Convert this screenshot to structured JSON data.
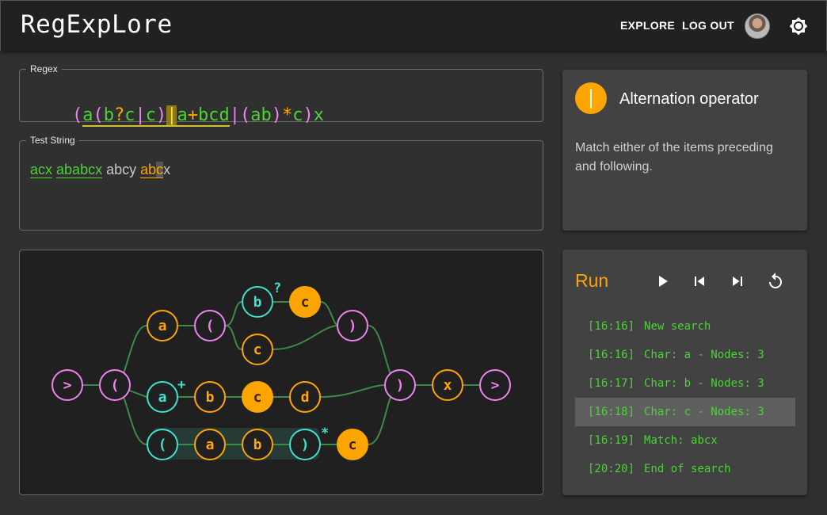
{
  "app": {
    "title": "RegExpLore"
  },
  "nav": {
    "explore": "EXPLORE",
    "logout": "LOG OUT"
  },
  "regex": {
    "label": "Regex",
    "tokens": [
      "(",
      "a",
      "(",
      "b",
      "?",
      "c",
      "|",
      "c",
      ")",
      "|",
      "a",
      "+",
      "b",
      "c",
      "d",
      "|",
      "(",
      "a",
      "b",
      ")",
      "*",
      "c",
      ")",
      "x"
    ]
  },
  "test": {
    "label": "Test String",
    "parts": [
      "acx",
      " ",
      "ababcx",
      " abcy ",
      "ab",
      "c",
      "x"
    ]
  },
  "operator": {
    "symbol": "|",
    "title": "Alternation operator",
    "description": "Match either of the items preceding and following."
  },
  "graph": {
    "nodes": [
      ">",
      "(",
      "a",
      "(",
      "b",
      "c",
      "c",
      ")",
      "a",
      "b",
      "c",
      "d",
      "(",
      "a",
      "b",
      ")",
      "c",
      ")",
      "x",
      ">"
    ],
    "quantifiers": [
      "?",
      "+",
      "*"
    ]
  },
  "run": {
    "title": "Run",
    "log": [
      {
        "time": "[16:16]",
        "text": "New search"
      },
      {
        "time": "[16:16]",
        "text": "Char: a - Nodes: 3"
      },
      {
        "time": "[16:17]",
        "text": "Char: b - Nodes: 3"
      },
      {
        "time": "[16:18]",
        "text": "Char: c - Nodes: 3"
      },
      {
        "time": "[16:19]",
        "text": "Match: abcx"
      },
      {
        "time": "[20:20]",
        "text": "End of search"
      }
    ],
    "active_index": 3
  },
  "colors": {
    "bracket": "#ee82ee",
    "literal": "#4cd137",
    "active": "#ffa500",
    "quantifier_group": "#40e0d0",
    "background": "#303030",
    "appbar": "#212121"
  },
  "icons": [
    "brightness-icon",
    "play-icon",
    "skip-previous-icon",
    "skip-next-icon",
    "replay-icon"
  ]
}
